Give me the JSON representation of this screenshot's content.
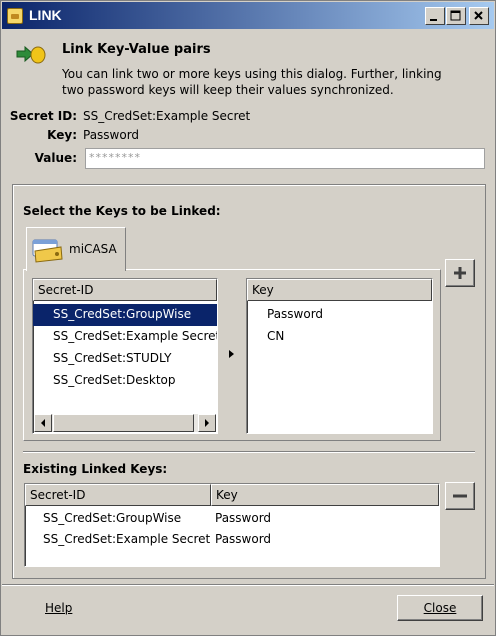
{
  "window": {
    "title": "LINK"
  },
  "header": {
    "heading": "Link Key-Value pairs",
    "description": "You can link two or more keys using this dialog. Further, linking two password keys will keep their values synchronized."
  },
  "info": {
    "secret_id_label": "Secret ID:",
    "secret_id_value": "SS_CredSet:Example Secret",
    "key_label": "Key:",
    "key_value": "Password",
    "value_label": "Value:",
    "value_masked": "********"
  },
  "select_section": {
    "title": "Select the Keys to be Linked:",
    "tab_label": "miCASA",
    "secret_column_header": "Secret-ID",
    "secret_rows": [
      "SS_CredSet:GroupWise",
      "SS_CredSet:Example Secret",
      "SS_CredSet:STUDLY",
      "SS_CredSet:Desktop"
    ],
    "selected_index": 0,
    "key_column_header": "Key",
    "key_rows": [
      "Password",
      "CN"
    ],
    "add_button": "+"
  },
  "linked_section": {
    "title": "Existing Linked Keys:",
    "columns": [
      "Secret-ID",
      "Key"
    ],
    "rows": [
      {
        "secret": "SS_CredSet:GroupWise",
        "key": "Password"
      },
      {
        "secret": "SS_CredSet:Example Secret",
        "key": "Password"
      }
    ],
    "remove_button": "−"
  },
  "footer": {
    "help_label": "Help",
    "close_label": "Close"
  },
  "colors": {
    "titlebar_start": "#0a246a",
    "titlebar_end": "#a6caf0",
    "selection": "#0a246a",
    "face": "#d4d0c8"
  }
}
